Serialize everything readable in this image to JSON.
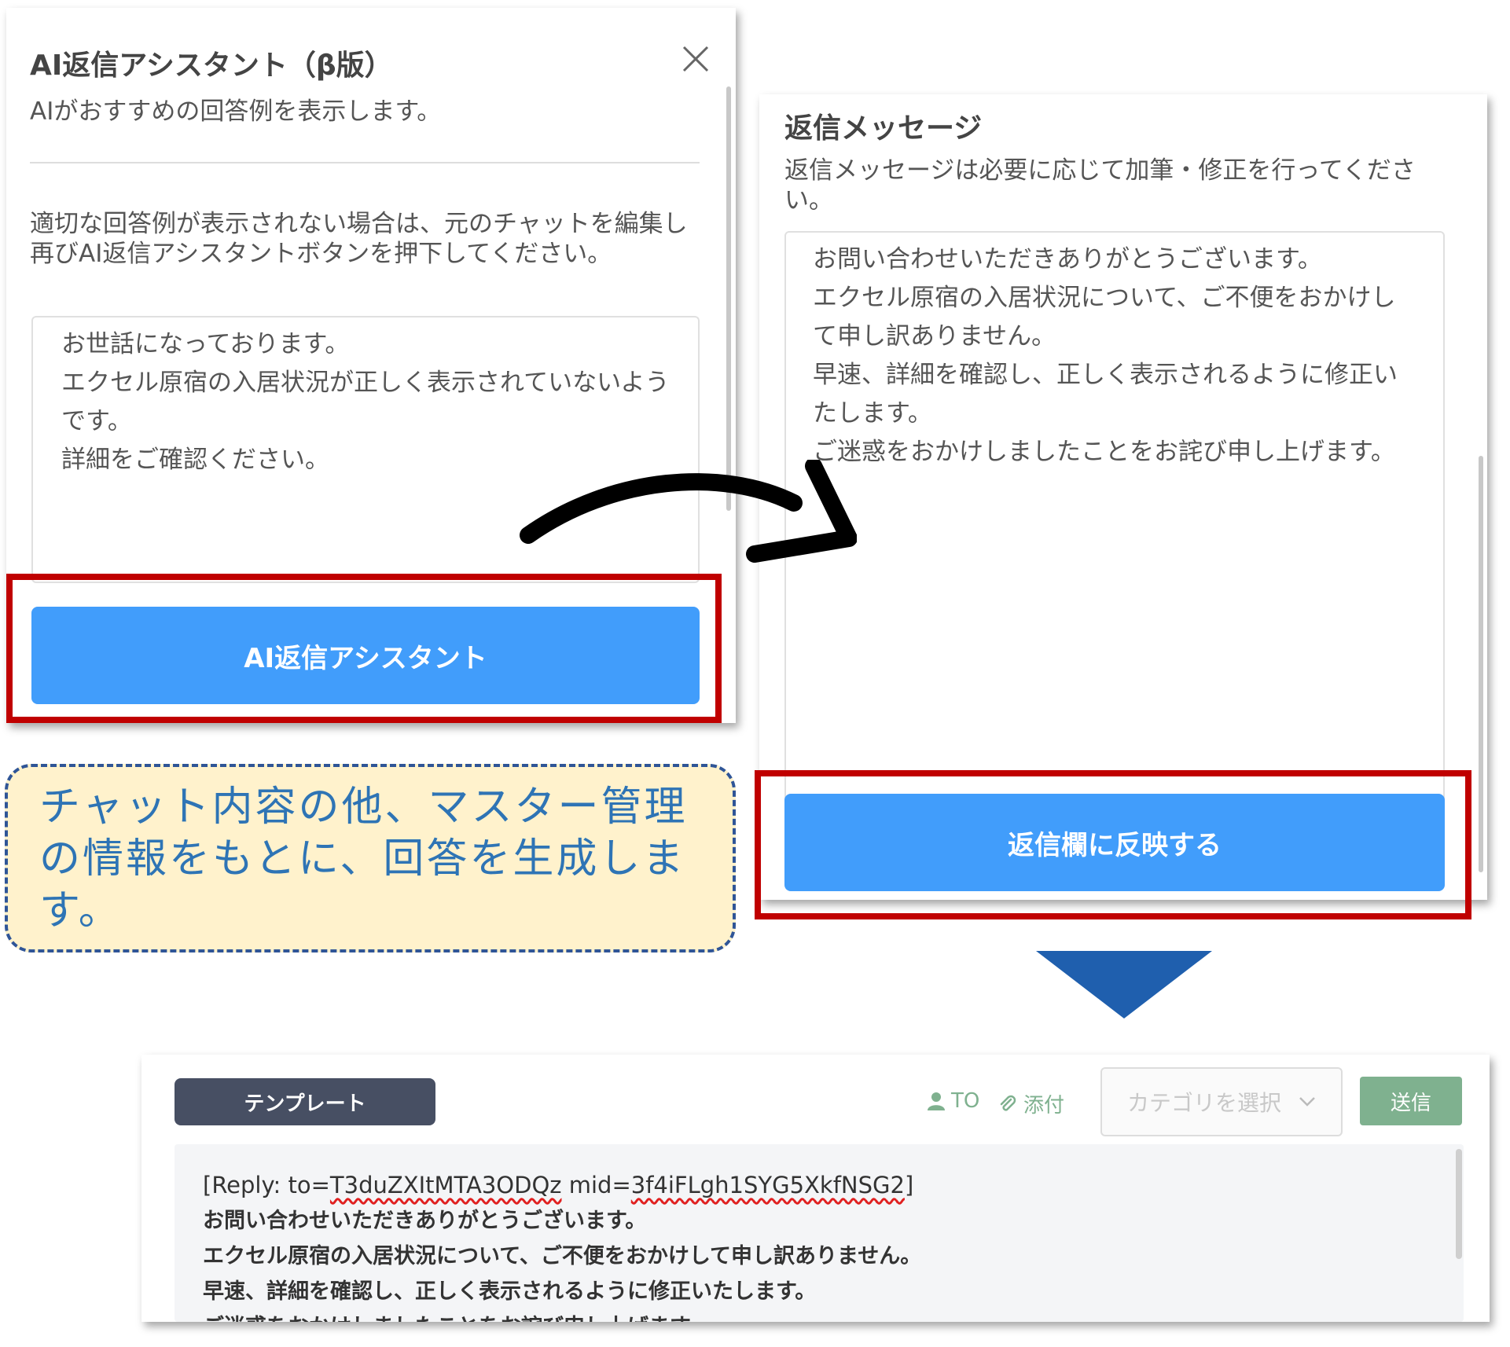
{
  "ai_panel": {
    "title": "AI返信アシスタント（β版）",
    "subtitle": "AIがおすすめの回答例を表示します。",
    "hint": "適切な回答例が表示されない場合は、元のチャットを編集し再びAI返信アシスタントボタンを押下してください。",
    "input_text": "お世話になっております。\nエクセル原宿の入居状況が正しく表示されていないようです。\n詳細をご確認ください。",
    "button_label": "AI返信アシスタント"
  },
  "reply_panel": {
    "title": "返信メッセージ",
    "description": "返信メッセージは必要に応じて加筆・修正を行ってください。",
    "reply_text": "お問い合わせいただきありがとうございます。\nエクセル原宿の入居状況について、ご不便をおかけして申し訳ありません。\n早速、詳細を確認し、正しく表示されるように修正いたします。\nご迷惑をおかけしましたことをお詫び申し上げます。",
    "button_label": "返信欄に反映する"
  },
  "callout": {
    "text": "チャット内容の他、マスター管理の情報をもとに、回答を生成します。"
  },
  "composer": {
    "template_label": "テンプレート",
    "to_label": "TO",
    "attach_label": "添付",
    "category_placeholder": "カテゴリを選択",
    "send_label": "送信",
    "reply_prefix": "[Reply: to=",
    "reply_to": "T3duZXItMTA3ODQz",
    "reply_mid_label": " mid=",
    "reply_mid": "3f4iFLgh1SYG5XkfNSG2",
    "reply_suffix": "]",
    "lines": [
      "お問い合わせいただきありがとうございます。",
      "エクセル原宿の入居状況について、ご不便をおかけして申し訳ありません。",
      "早速、詳細を確認し、正しく表示されるように修正いたします。",
      "ご迷惑をおかけしましたことをお詫び申し上げます。"
    ]
  },
  "colors": {
    "primary_button": "#419dfb",
    "highlight_frame": "#c00000",
    "callout_bg": "#fff2cc",
    "callout_border": "#2f5597",
    "callout_text": "#2e74b5",
    "send_button": "#7fb18f",
    "template_button": "#474f63",
    "flow_triangle": "#1f5fae"
  },
  "icons": [
    "close-icon",
    "curved-arrow-icon",
    "down-triangle-icon",
    "user-icon",
    "paperclip-icon",
    "chevron-down-icon"
  ]
}
